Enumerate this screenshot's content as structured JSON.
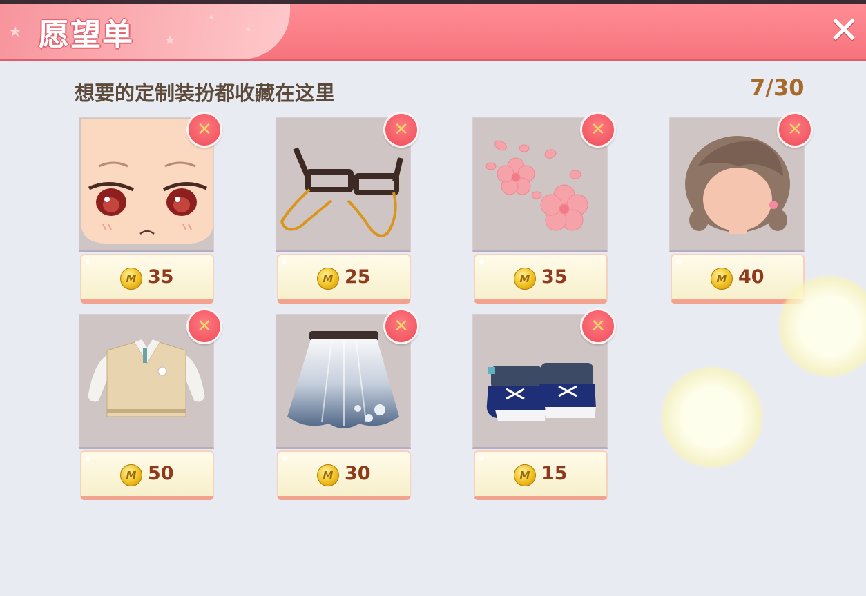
{
  "header": {
    "title": "愿望单",
    "close_label": "✕"
  },
  "subtitle": "想要的定制装扮都收藏在这里",
  "count": "7/30",
  "colors": {
    "header": "#f6737d",
    "background": "#e9ebf3",
    "price_text": "#8e3a1c",
    "count_text": "#a86a2b"
  },
  "items": [
    {
      "name": "face-icon",
      "price": "35"
    },
    {
      "name": "glasses-icon",
      "price": "25"
    },
    {
      "name": "sakura-blossoms-icon",
      "price": "35"
    },
    {
      "name": "braided-hair-icon",
      "price": "40"
    },
    {
      "name": "sweater-vest-icon",
      "price": "50"
    },
    {
      "name": "skirt-icon",
      "price": "30"
    },
    {
      "name": "sneakers-icon",
      "price": "15"
    }
  ],
  "icons": {
    "remove": "remove-icon",
    "coin": "coin-icon",
    "close": "close-icon",
    "coin_glyph": "M"
  }
}
